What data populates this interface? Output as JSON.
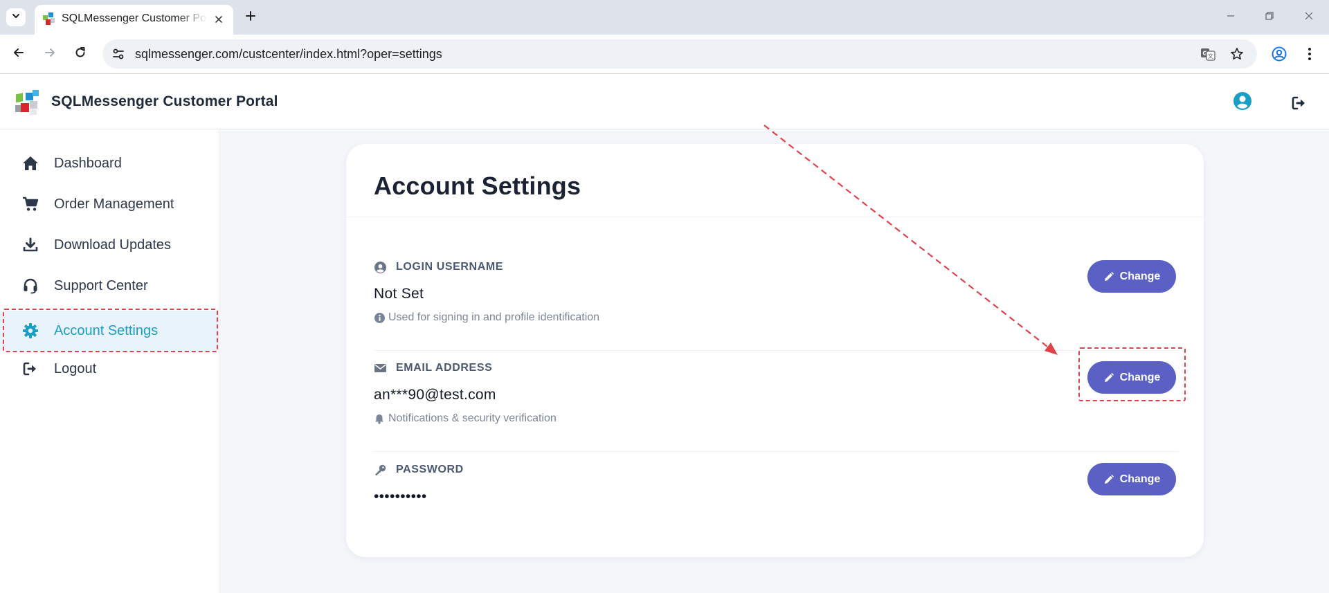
{
  "browser": {
    "tab_title": "SQLMessenger Customer Portal",
    "url": "sqlmessenger.com/custcenter/index.html?oper=settings"
  },
  "header": {
    "title": "SQLMessenger Customer Portal"
  },
  "sidebar": {
    "items": [
      {
        "label": "Dashboard",
        "icon": "home-icon"
      },
      {
        "label": "Order Management",
        "icon": "cart-icon"
      },
      {
        "label": "Download Updates",
        "icon": "download-icon"
      },
      {
        "label": "Support Center",
        "icon": "headset-icon"
      },
      {
        "label": "Account Settings",
        "icon": "gear-icon",
        "active": true
      },
      {
        "label": "Logout",
        "icon": "logout-icon"
      }
    ]
  },
  "settings": {
    "title": "Account Settings",
    "button_label": "Change",
    "fields": [
      {
        "label": "LOGIN USERNAME",
        "value": "Not Set",
        "hint": "Used for signing in and profile identification",
        "icon": "user-circle-icon",
        "hint_icon": "info-icon"
      },
      {
        "label": "EMAIL ADDRESS",
        "value": "an***90@test.com",
        "hint": "Notifications & security verification",
        "icon": "envelope-icon",
        "hint_icon": "bell-icon"
      },
      {
        "label": "PASSWORD",
        "value": "••••••••••",
        "icon": "key-icon"
      }
    ]
  },
  "colors": {
    "accent": "#5b60c4",
    "active_text": "#1a9fc4",
    "annotation": "#e2404a"
  }
}
